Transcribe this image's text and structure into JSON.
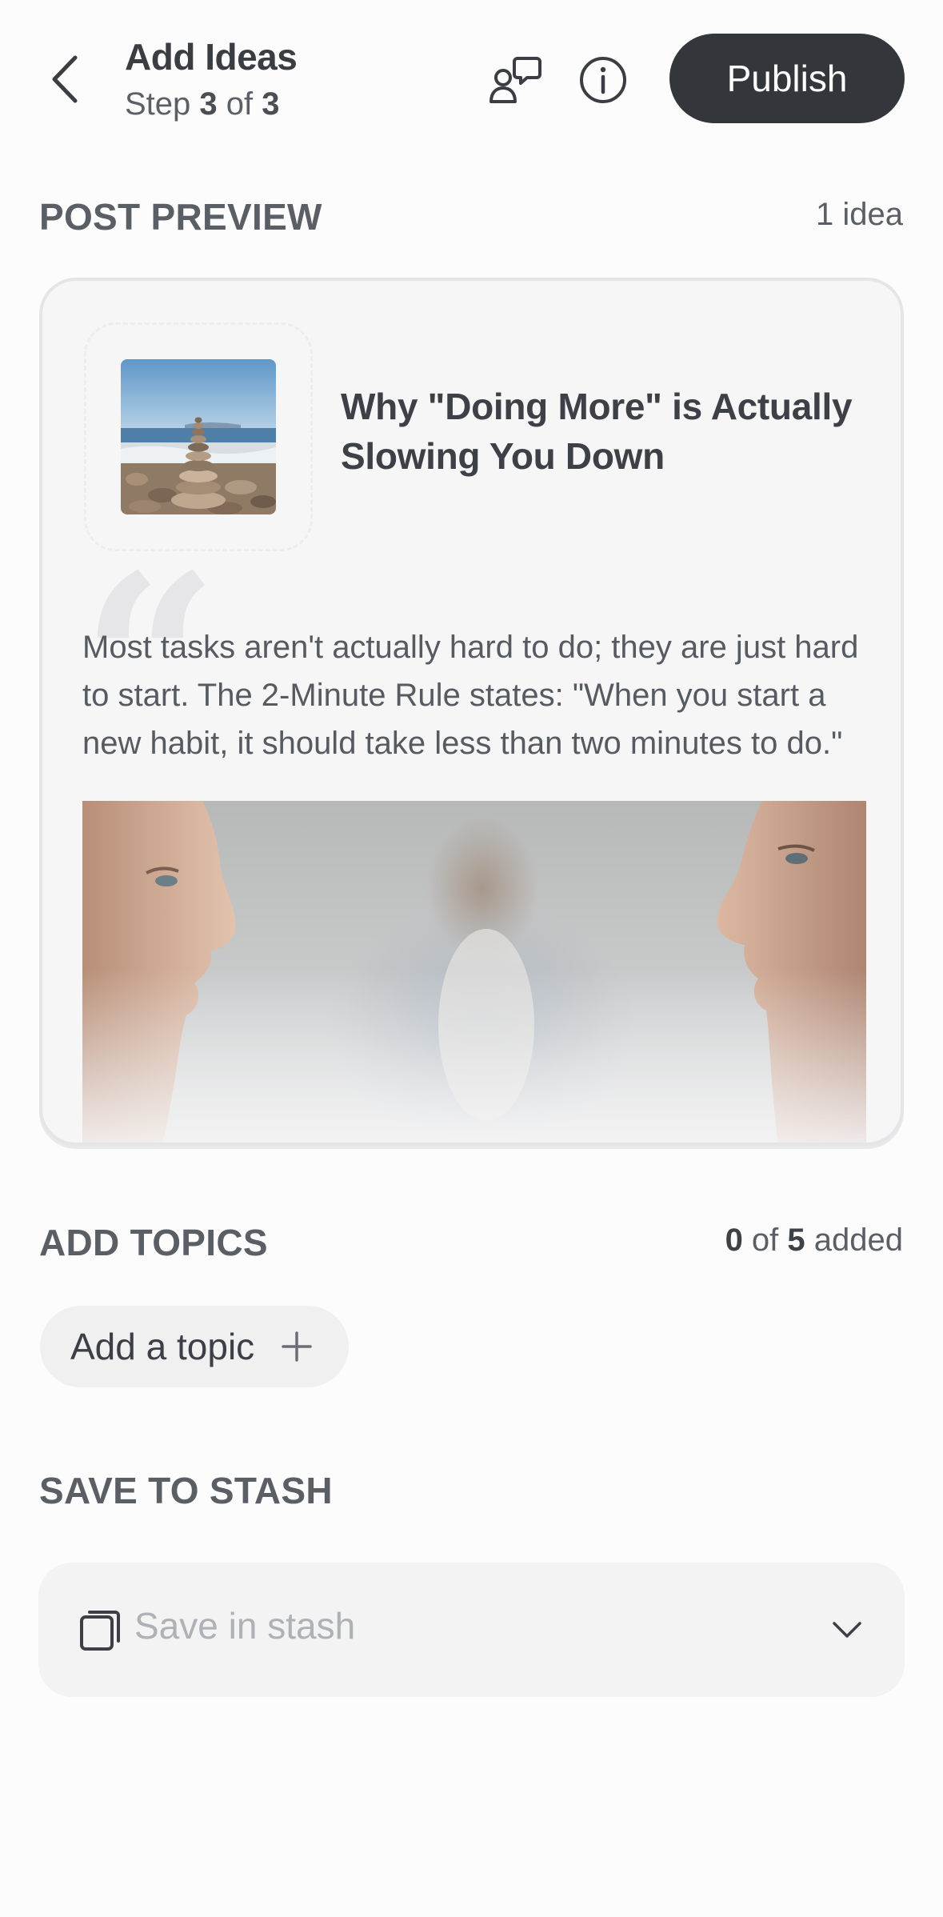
{
  "header": {
    "back_icon": "chevron-left-icon",
    "title": "Add Ideas",
    "step_prefix": "Step ",
    "step_current": "3",
    "step_mid": " of ",
    "step_total": "3",
    "chat_icon": "people-chat-icon",
    "info_icon": "info-icon",
    "publish_label": "Publish"
  },
  "preview": {
    "section_title": "POST PREVIEW",
    "count_label": "1 idea",
    "headline": "Why \"Doing More\" is Actually Slowing You Down",
    "quote": "Most tasks aren't actually hard to do; they are just hard to start. The 2-Minute Rule states: \"When you start a new habit, it should take less than two minutes to do.\"",
    "quote_mark": "“"
  },
  "topics": {
    "section_title": "ADD TOPICS",
    "added_count": "0",
    "of_label": " of ",
    "max_count": "5",
    "added_suffix": " added",
    "add_label": "Add a topic"
  },
  "stash": {
    "section_title": "SAVE TO STASH",
    "placeholder": "Save in stash"
  }
}
